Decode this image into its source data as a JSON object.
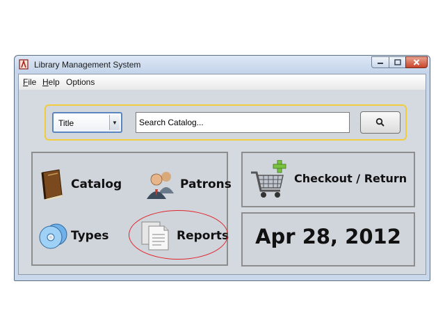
{
  "window": {
    "title": "Library Management System",
    "controls": [
      "minimize-icon",
      "maximize-icon",
      "close-icon"
    ]
  },
  "menu": {
    "file": {
      "mnemonic": "F",
      "rest": "ile"
    },
    "help": {
      "mnemonic": "H",
      "rest": "elp"
    },
    "options": "Options"
  },
  "search": {
    "field_select": "Title",
    "placeholder": "Search Catalog...",
    "button_icon": "search-icon",
    "border_color": "#f2cd3b"
  },
  "main": {
    "catalog": "Catalog",
    "patrons": "Patrons",
    "types": "Types",
    "reports": "Reports"
  },
  "checkout": {
    "label": "Checkout / Return"
  },
  "date": "Apr 28, 2012",
  "annotation": {
    "color": "#e0262b",
    "target": "Reports"
  }
}
